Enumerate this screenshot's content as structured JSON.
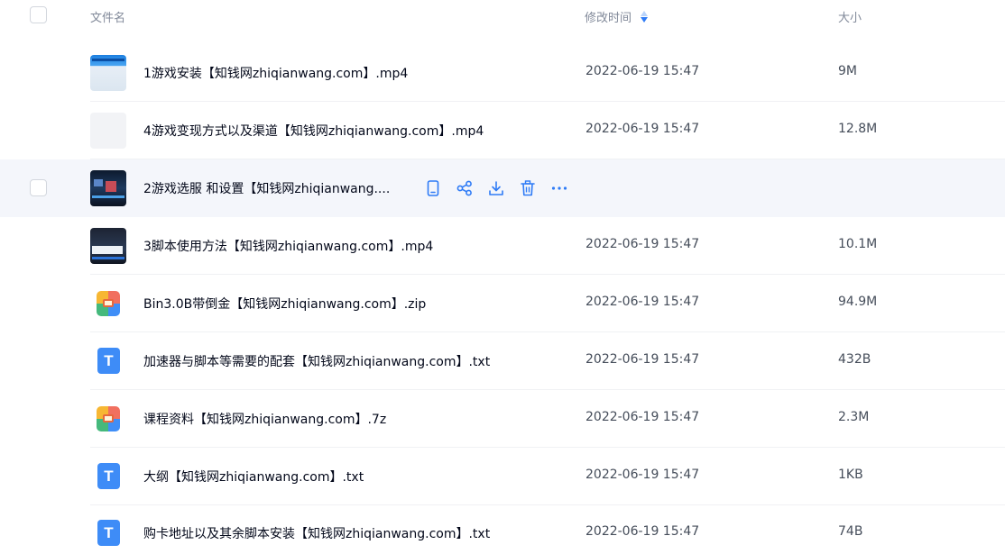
{
  "header": {
    "name_label": "文件名",
    "time_label": "修改时间",
    "size_label": "大小"
  },
  "files": [
    {
      "name": "1游戏安装【知钱网zhiqianwang.com】.mp4",
      "time": "2022-06-19 15:47",
      "size": "9M",
      "icon": "video-thumbnail"
    },
    {
      "name": "4游戏变现方式以及渠道【知钱网zhiqianwang.com】.mp4",
      "time": "2022-06-19 15:47",
      "size": "12.8M",
      "icon": "video-thumbnail"
    },
    {
      "name": "2游戏选服 和设置【知钱网zhiqianwang....",
      "time": "",
      "size": "",
      "icon": "video-thumbnail"
    },
    {
      "name": "3脚本使用方法【知钱网zhiqianwang.com】.mp4",
      "time": "2022-06-19 15:47",
      "size": "10.1M",
      "icon": "video-thumbnail"
    },
    {
      "name": "Bin3.0B带倒金【知钱网zhiqianwang.com】.zip",
      "time": "2022-06-19 15:47",
      "size": "94.9M",
      "icon": "zip-icon"
    },
    {
      "name": "加速器与脚本等需要的配套【知钱网zhiqianwang.com】.txt",
      "time": "2022-06-19 15:47",
      "size": "432B",
      "icon": "txt-icon"
    },
    {
      "name": "课程资料【知钱网zhiqianwang.com】.7z",
      "time": "2022-06-19 15:47",
      "size": "2.3M",
      "icon": "zip-icon"
    },
    {
      "name": "大纲【知钱网zhiqianwang.com】.txt",
      "time": "2022-06-19 15:47",
      "size": "1KB",
      "icon": "txt-icon"
    },
    {
      "name": "购卡地址以及其余脚本安装【知钱网zhiqianwang.com】.txt",
      "time": "2022-06-19 15:47",
      "size": "74B",
      "icon": "txt-icon"
    }
  ],
  "hover_actions": [
    "phone-icon",
    "share-icon",
    "download-icon",
    "delete-icon",
    "more-icon"
  ],
  "txt_icon_letter": "T",
  "colors": {
    "accent": "#2e7bf6",
    "hover_row": "#f4f6fb",
    "txt_icon": "#3e8cf7"
  }
}
